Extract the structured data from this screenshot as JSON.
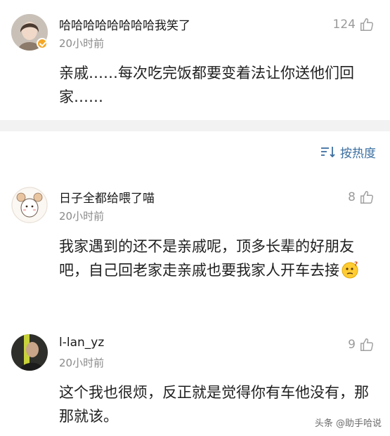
{
  "comments": [
    {
      "username": "哈哈哈哈哈哈哈哈我笑了",
      "time": "20小时前",
      "likes": "124",
      "text": "亲戚……每次吃完饭都要变着法让你送他们回家……",
      "avatar_icon": "woman-avatar-icon",
      "verified": true
    },
    {
      "username": "日子全都给喂了喵",
      "time": "20小时前",
      "likes": "8",
      "text": "我家遇到的还不是亲戚呢，顶多长辈的好朋友吧，自己回老家走亲戚也要我家人开车去接",
      "avatar_icon": "illustrated-girl-avatar-icon",
      "emoji": "thinking-face-emoji"
    },
    {
      "username": "l-lan_yz",
      "time": "20小时前",
      "likes": "9",
      "text": "这个我也很烦，反正就是觉得你有车他没有，那那就该。",
      "avatar_icon": "man-avatar-icon"
    }
  ],
  "sort": {
    "label": "按热度",
    "icon": "sort-icon"
  },
  "watermark": {
    "text": "头条 @助手哈说"
  },
  "colors": {
    "link": "#3c6fa0",
    "muted": "#8a8a8a",
    "divider": "#f2f2f2",
    "badge": "#f5a623"
  }
}
